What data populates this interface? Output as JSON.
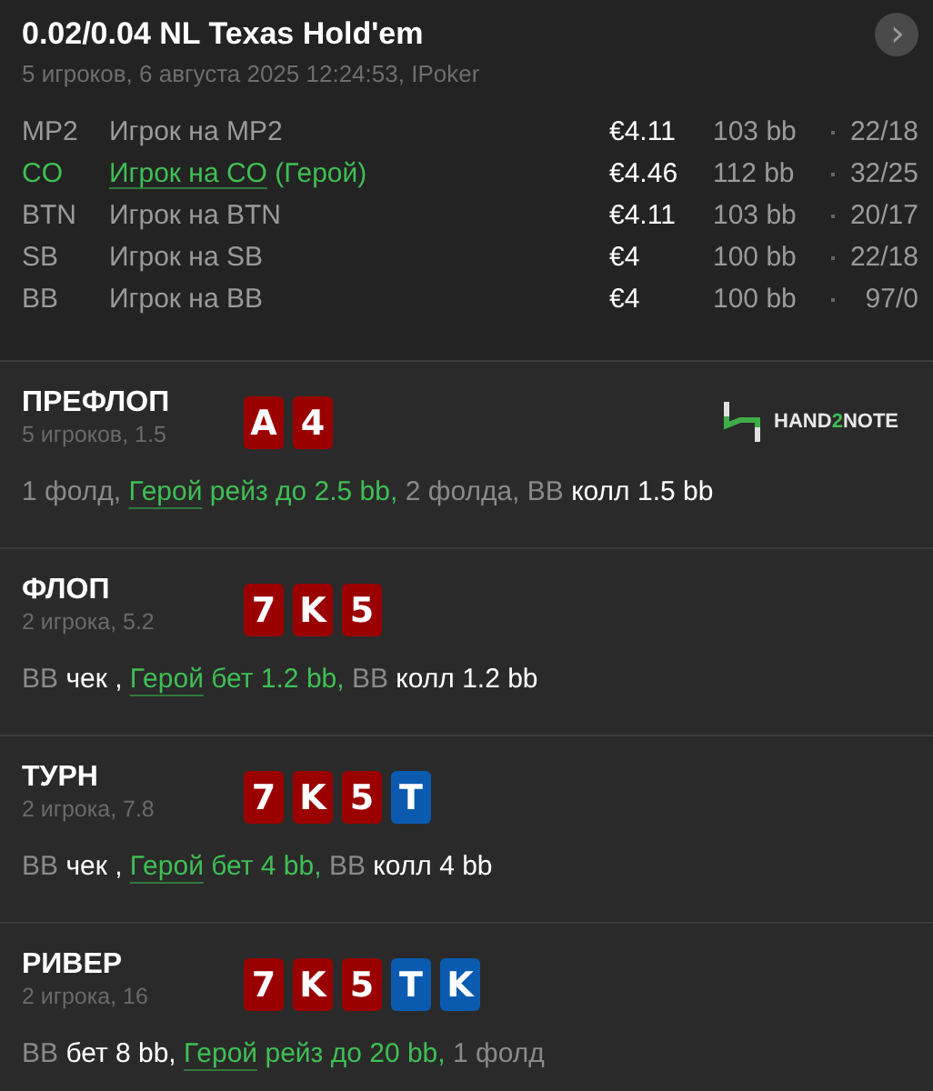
{
  "header": {
    "title": "0.02/0.04 NL Texas Hold'em",
    "subtitle": "5 игроков, 6 августа 2025 12:24:53, IPoker",
    "next_button": "›"
  },
  "players": [
    {
      "position": "MP2",
      "name": "Игрок на MP2",
      "hero": false,
      "stack": "€4.11",
      "bb": "103 bb",
      "stats": "22/18"
    },
    {
      "position": "CO",
      "name": "Игрок на CO",
      "suffix": " (Герой)",
      "hero": true,
      "stack": "€4.46",
      "bb": "112 bb",
      "stats": "32/25"
    },
    {
      "position": "BTN",
      "name": "Игрок на BTN",
      "hero": false,
      "stack": "€4.11",
      "bb": "103 bb",
      "stats": "20/17"
    },
    {
      "position": "SB",
      "name": "Игрок на SB",
      "hero": false,
      "stack": "€4",
      "bb": "100 bb",
      "stats": "22/18"
    },
    {
      "position": "BB",
      "name": "Игрок на BB",
      "hero": false,
      "stack": "€4",
      "bb": "100 bb",
      "stats": "97/0"
    }
  ],
  "streets": [
    {
      "name": "ПРЕФЛОП",
      "info": "5 игроков, 1.5",
      "cards": [
        {
          "rank": "A",
          "color": "#9b0000"
        },
        {
          "rank": "4",
          "color": "#9b0000"
        }
      ],
      "logo": {
        "before": "HAND",
        "accent": "2",
        "after": "NOTE"
      },
      "actions": [
        {
          "kind": "muted",
          "text": "1 фолд, "
        },
        {
          "kind": "link",
          "text": "Герой"
        },
        {
          "kind": "hero",
          "text": " рейз до 2.5 bb,"
        },
        {
          "kind": "muted",
          "text": " 2 фолда, BB "
        },
        {
          "kind": "bold",
          "text": "колл 1.5 bb"
        }
      ]
    },
    {
      "name": "ФЛОП",
      "info": "2 игрока, 5.2",
      "cards": [
        {
          "rank": "7",
          "color": "#9b0000"
        },
        {
          "rank": "K",
          "color": "#9b0000"
        },
        {
          "rank": "5",
          "color": "#9b0000"
        }
      ],
      "actions": [
        {
          "kind": "muted",
          "text": "BB "
        },
        {
          "kind": "bold",
          "text": "чек , "
        },
        {
          "kind": "link",
          "text": "Герой"
        },
        {
          "kind": "hero",
          "text": " бет 1.2 bb,"
        },
        {
          "kind": "muted",
          "text": " BB "
        },
        {
          "kind": "bold",
          "text": "колл 1.2 bb"
        }
      ]
    },
    {
      "name": "ТУРН",
      "info": "2 игрока, 7.8",
      "cards": [
        {
          "rank": "7",
          "color": "#9b0000"
        },
        {
          "rank": "K",
          "color": "#9b0000"
        },
        {
          "rank": "5",
          "color": "#9b0000"
        },
        {
          "rank": "T",
          "color": "#0a5bb0"
        }
      ],
      "actions": [
        {
          "kind": "muted",
          "text": "BB "
        },
        {
          "kind": "bold",
          "text": "чек , "
        },
        {
          "kind": "link",
          "text": "Герой"
        },
        {
          "kind": "hero",
          "text": " бет 4 bb,"
        },
        {
          "kind": "muted",
          "text": " BB "
        },
        {
          "kind": "bold",
          "text": "колл 4 bb"
        }
      ]
    },
    {
      "name": "РИВЕР",
      "info": "2 игрока, 16",
      "cards": [
        {
          "rank": "7",
          "color": "#9b0000"
        },
        {
          "rank": "K",
          "color": "#9b0000"
        },
        {
          "rank": "5",
          "color": "#9b0000"
        },
        {
          "rank": "T",
          "color": "#0a5bb0"
        },
        {
          "rank": "K",
          "color": "#0a5bb0"
        }
      ],
      "actions": [
        {
          "kind": "muted",
          "text": "BB "
        },
        {
          "kind": "bold",
          "text": "бет 8 bb, "
        },
        {
          "kind": "link",
          "text": "Герой"
        },
        {
          "kind": "hero",
          "text": " рейз до 20 bb,"
        },
        {
          "kind": "muted",
          "text": " 1 фолд"
        }
      ]
    }
  ]
}
